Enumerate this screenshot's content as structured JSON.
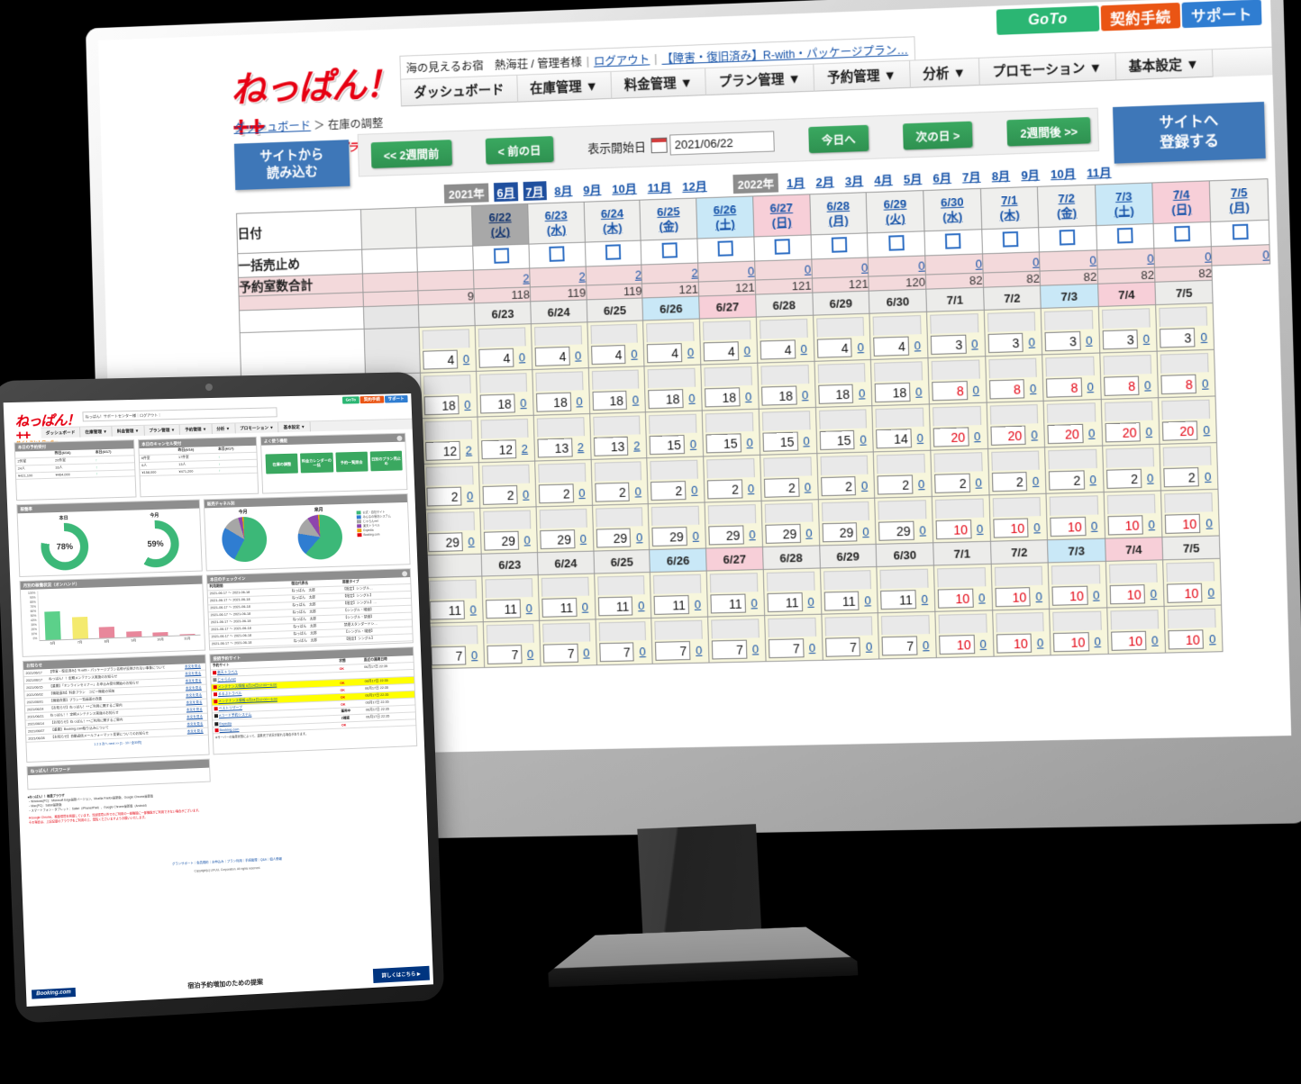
{
  "desktop": {
    "util_buttons": [
      {
        "name": "goto",
        "label": "GoTo",
        "color": "#2bb673"
      },
      {
        "name": "contract",
        "label": "契約手続",
        "color": "#ea5514"
      },
      {
        "name": "support",
        "label": "サポート",
        "color": "#2f7dd1"
      }
    ],
    "account": {
      "property": "海の見えるお宿　熱海荘 / 管理者様",
      "logout": "ログアウト",
      "notice": "【障害・復旧済み】R-with・パッケージプラン…"
    },
    "logo": {
      "line1": "ねっぱん！",
      "plus": "++",
      "line2": "サイトコントローラー",
      "line2b": "プラスプラス"
    },
    "nav": [
      "ダッシュボード",
      "在庫管理 ▼",
      "料金管理 ▼",
      "プラン管理 ▼",
      "予約管理 ▼",
      "分析 ▼",
      "プロモーション ▼",
      "基本設定 ▼"
    ],
    "breadcrumb": {
      "root": "ダッシュボード",
      "sep": "＞",
      "current": "在庫の調整"
    },
    "toolbar": {
      "load_button": [
        "サイトから",
        "読み込む"
      ],
      "prev_2week": "<< 2週間前",
      "prev_day": "< 前の日",
      "start_label": "表示開始日",
      "start_date": "2021/06/22",
      "today": "今日へ",
      "next_day": "次の日 >",
      "next_2week": "2週間後 >>",
      "register_button": [
        "サイトへ",
        "登録する"
      ]
    },
    "month_nav": {
      "year1": "2021年",
      "months1": [
        "6月",
        "7月",
        "8月",
        "9月",
        "10月",
        "11月",
        "12月"
      ],
      "active1": [
        "6月",
        "7月"
      ],
      "year2": "2022年",
      "months2": [
        "1月",
        "2月",
        "3月",
        "4月",
        "5月",
        "6月",
        "7月",
        "8月",
        "9月",
        "10月",
        "11月"
      ]
    },
    "table": {
      "row_labels": [
        "日付",
        "一括売止め",
        "予約室数合計"
      ],
      "days": [
        {
          "date": "6/22",
          "dow": "(火)",
          "kind": "today"
        },
        {
          "date": "6/23",
          "dow": "(水)",
          "kind": "wd"
        },
        {
          "date": "6/24",
          "dow": "(木)",
          "kind": "wd"
        },
        {
          "date": "6/25",
          "dow": "(金)",
          "kind": "wd"
        },
        {
          "date": "6/26",
          "dow": "(土)",
          "kind": "sat"
        },
        {
          "date": "6/27",
          "dow": "(日)",
          "kind": "sun"
        },
        {
          "date": "6/28",
          "dow": "(月)",
          "kind": "wd"
        },
        {
          "date": "6/29",
          "dow": "(火)",
          "kind": "wd"
        },
        {
          "date": "6/30",
          "dow": "(水)",
          "kind": "wd"
        },
        {
          "date": "7/1",
          "dow": "(木)",
          "kind": "wd"
        },
        {
          "date": "7/2",
          "dow": "(金)",
          "kind": "wd"
        },
        {
          "date": "7/3",
          "dow": "(土)",
          "kind": "sat"
        },
        {
          "date": "7/4",
          "dow": "(日)",
          "kind": "sun"
        },
        {
          "date": "7/5",
          "dow": "(月)",
          "kind": "wd"
        }
      ],
      "reserved_total": [
        "2",
        "2",
        "2",
        "2",
        "0",
        "0",
        "0",
        "0",
        "0",
        "0",
        "0",
        "0",
        "0",
        "0"
      ],
      "capacity_total": [
        "119",
        "118",
        "119",
        "119",
        "121",
        "121",
        "121",
        "121",
        "120",
        "82",
        "82",
        "82",
        "82",
        "82"
      ],
      "plan_rows": [
        {
          "values": [
            "4",
            "4",
            "4",
            "4",
            "4",
            "4",
            "4",
            "4",
            "4",
            "3",
            "3",
            "3",
            "3",
            "3"
          ],
          "zeros": [
            "0",
            "0",
            "0",
            "0",
            "0",
            "0",
            "0",
            "0",
            "0",
            "0",
            "0",
            "0",
            "0",
            "0"
          ],
          "red": false
        },
        {
          "values": [
            "18",
            "18",
            "18",
            "18",
            "18",
            "18",
            "18",
            "18",
            "18",
            "8",
            "8",
            "8",
            "8",
            "8"
          ],
          "zeros": [
            "0",
            "0",
            "0",
            "0",
            "0",
            "0",
            "0",
            "0",
            "0",
            "0",
            "0",
            "0",
            "0",
            "0"
          ],
          "red": "tail"
        },
        {
          "values": [
            "12",
            "12",
            "13",
            "13",
            "15",
            "15",
            "15",
            "15",
            "14",
            "20",
            "20",
            "20",
            "20",
            "20"
          ],
          "zeros": [
            "2",
            "2",
            "2",
            "2",
            "0",
            "0",
            "0",
            "0",
            "0",
            "0",
            "0",
            "0",
            "0",
            "0"
          ],
          "red": "tail"
        },
        {
          "values": [
            "2",
            "2",
            "2",
            "2",
            "2",
            "2",
            "2",
            "2",
            "2",
            "2",
            "2",
            "2",
            "2",
            "2"
          ],
          "zeros": [
            "0",
            "0",
            "0",
            "0",
            "0",
            "0",
            "0",
            "0",
            "0",
            "0",
            "0",
            "0",
            "0",
            "0"
          ],
          "red": false
        },
        {
          "values": [
            "29",
            "29",
            "29",
            "29",
            "29",
            "29",
            "29",
            "29",
            "29",
            "10",
            "10",
            "10",
            "10",
            "10"
          ],
          "zeros": [
            "0",
            "0",
            "0",
            "0",
            "0",
            "0",
            "0",
            "0",
            "0",
            "0",
            "0",
            "0",
            "0",
            "0"
          ],
          "red": "tail"
        }
      ],
      "plan_rows2": [
        {
          "values": [
            "11",
            "11",
            "11",
            "11",
            "11",
            "11",
            "11",
            "11",
            "11",
            "10",
            "10",
            "10",
            "10",
            "10"
          ],
          "zeros": [
            "0",
            "0",
            "0",
            "0",
            "0",
            "0",
            "0",
            "0",
            "0",
            "0",
            "0",
            "0",
            "0",
            "0"
          ],
          "red": "tail"
        },
        {
          "values": [
            "7",
            "7",
            "7",
            "7",
            "7",
            "7",
            "7",
            "7",
            "7",
            "10",
            "10",
            "10",
            "10",
            "10"
          ],
          "zeros": [
            "0",
            "0",
            "0",
            "0",
            "0",
            "0",
            "0",
            "0",
            "0",
            "0",
            "0",
            "0",
            "0",
            "0"
          ],
          "red": "tail"
        }
      ]
    }
  },
  "tablet": {
    "util_buttons": [
      "GoTo",
      "契約手続",
      "サポート"
    ],
    "account": "ねっぱん！サポートセンター様｜ログアウト｜",
    "logo": {
      "a": "ねっぱん！++",
      "b": "サイトコントローラー"
    },
    "nav": [
      "ダッシュボード",
      "在庫管理 ▼",
      "料金管理 ▼",
      "プラン管理 ▼",
      "予約管理 ▼",
      "分析 ▼",
      "プロモーション ▼",
      "基本設定 ▼"
    ],
    "cards": {
      "today_bookings": {
        "title": "本日の予約受付",
        "columns": [
          "",
          "昨日(6/16)",
          "本日(6/17)",
          ""
        ],
        "rows": [
          [
            "2件室",
            "20件室",
            "↑"
          ],
          [
            "24人",
            "33人",
            "↑"
          ],
          [
            "¥421,100",
            "¥464,000",
            "↑"
          ]
        ]
      },
      "today_cancels": {
        "title": "本日のキャンセル受付",
        "columns": [
          "",
          "昨日(6/16)",
          "本日(6/17)",
          ""
        ],
        "rows": [
          [
            "6件室",
            "17件室",
            "↑"
          ],
          [
            "6人",
            "13人",
            "↑"
          ],
          [
            "¥158,000",
            "¥471,200",
            "↑"
          ]
        ]
      },
      "quick": {
        "title": "よく使う機能",
        "buttons": [
          "在庫の調整",
          "料金カレンダーの一括",
          "予約一覧照会",
          "日別のプラン売止め"
        ]
      },
      "occupancy": {
        "title": "稼働率",
        "items": [
          {
            "label": "本日",
            "value": "78%",
            "pct": 78
          },
          {
            "label": "今月",
            "value": "59%",
            "pct": 59
          }
        ]
      },
      "channels": {
        "title": "販売チャネル別",
        "legend": [
          {
            "name": "公式・自社サイト",
            "color": "#3cb878"
          },
          {
            "name": "みんなの宿泊システム",
            "color": "#2f7dd1"
          },
          {
            "name": "じゃらんnet",
            "color": "#a6a6a6"
          },
          {
            "name": "楽天トラベル",
            "color": "#8e44ad"
          },
          {
            "name": "Expedia",
            "color": "#f0a202"
          },
          {
            "name": "Booking.com",
            "color": "#e3000f"
          }
        ],
        "pies": [
          {
            "label": "今月",
            "slices": [
              {
                "color": "#3cb878",
                "pct": 58
              },
              {
                "color": "#2f7dd1",
                "pct": 26
              },
              {
                "color": "#a6a6a6",
                "pct": 12
              },
              {
                "color": "#8e44ad",
                "pct": 3
              },
              {
                "color": "#f0a202",
                "pct": 1
              }
            ]
          },
          {
            "label": "来月",
            "slices": [
              {
                "color": "#3cb878",
                "pct": 62
              },
              {
                "color": "#2f7dd1",
                "pct": 16
              },
              {
                "color": "#a6a6a6",
                "pct": 13
              },
              {
                "color": "#8e44ad",
                "pct": 8
              },
              {
                "color": "#f0a202",
                "pct": 1
              }
            ]
          }
        ]
      },
      "monthly": {
        "title": "月別の稼働状況（オンハンド）",
        "y_ticks": [
          "100%",
          "90%",
          "80%",
          "70%",
          "60%",
          "50%",
          "40%",
          "30%",
          "20%",
          "10%",
          "0%"
        ],
        "categories": [
          "6月",
          "7月",
          "8月",
          "9月",
          "10月",
          "11月"
        ],
        "values": [
          57,
          44,
          22,
          11,
          7,
          1
        ],
        "colors": [
          "#5cd08a",
          "#f4ea6e",
          "#e8879b",
          "#e8879b",
          "#e8879b",
          "#e8879b"
        ]
      },
      "checkin": {
        "title": "本日のチェックイン",
        "columns": [
          "利用期間",
          "宿泊代表名",
          "部屋タイプ"
        ],
        "rows": [
          [
            "2021-06-17 ～ 2021-06-18",
            "ねっぱん　太郎",
            "【限定】シングル…"
          ],
          [
            "2021-06-17 ～ 2021-06-18",
            "ねっぱん　太郎",
            "【限定】シングル】"
          ],
          [
            "2021-06-17 ～ 2021-06-18",
            "ねっぱん　太郎",
            "【限定】シングル】…"
          ],
          [
            "2021-06-17 ～ 2021-06-18",
            "ねっぱん　太郎",
            "【シングル・喫煙】"
          ],
          [
            "2021-06-17 ～ 2021-06-18",
            "ねっぱん　太郎",
            "【シングル・禁煙】"
          ],
          [
            "2021-06-17 ～ 2021-06-18",
            "ねっぱん　太郎",
            "禁煙スタンダードシ…"
          ],
          [
            "2021-06-17 ～ 2021-06-18",
            "ねっぱん　太郎",
            "【シングル・喫煙】"
          ],
          [
            "2021-06-17 ～ 2021-06-18",
            "ねっぱん　太郎",
            "【限定】シングル】"
          ]
        ]
      },
      "news": {
        "title": "お知らせ",
        "rows": [
          [
            "2021/06/17",
            "【障害・復旧済み】R-with・パッケージプラン名称が反映されない事象について",
            "本文を見る"
          ],
          [
            "2021/06/17",
            "ねっぱん！！定期メンテナンス実施のお知らせ",
            "本文を見る"
          ],
          [
            "2021/06/15",
            "【重要】「オンラインセミナー」お申込み受付開始のお知らせ",
            "本文を見る"
          ],
          [
            "2021/06/02",
            "【機能追加】料金プラン　コピー機能の追加",
            "本文を見る"
          ],
          [
            "2021/06/01",
            "【機能改善】プラン一覧画面の改善",
            "本文を見る"
          ],
          [
            "2021/06/24",
            "【お知らせ】ねっぱん！++ご利用に関するご案内",
            "本文を見る"
          ],
          [
            "2021/06/21",
            "ねっぱん！！定期メンテナンス実施のお知らせ",
            "本文を見る"
          ],
          [
            "2021/06/14",
            "【お知らせ】ねっぱん！++ご利用に関するご案内",
            "本文を見る"
          ],
          [
            "2021/06/07",
            "【重要】Booking.com取り込みについて",
            "本文を見る"
          ],
          [
            "2021/06/28",
            "【お知らせ】自動返信メールフォーマット変更についてのお知らせ",
            "本文を見る"
          ]
        ],
        "pager": "1 2 3 次へ  next >>  [1 - 10 / 全30件]"
      },
      "sites": {
        "title": "接続予約サイト",
        "columns": [
          "予約サイト",
          "状態",
          "直近の連携日時"
        ],
        "rows": [
          {
            "name": "楽天トラベル",
            "status": "OK",
            "status_color": "#e3000f",
            "time": "06月17日 22:35",
            "highlight": false
          },
          {
            "name": "じゃらんnet",
            "status": "",
            "status_color": "",
            "time": "",
            "highlight": false
          },
          {
            "name": "メンテナンス情報\n6月24日12:00～6:00",
            "status": "OK",
            "status_color": "#e3000f",
            "time": "06月17日 22:35",
            "highlight": true
          },
          {
            "name": "るるぶトラベル",
            "status": "OK",
            "status_color": "#e3000f",
            "time": "06月17日 22:35",
            "highlight": false
          },
          {
            "name": "メンテナンス情報\n6月24日12:00～6:00",
            "status": "OK",
            "status_color": "#e3000f",
            "time": "06月17日 22:35",
            "highlight": true
          },
          {
            "name": "ベストリザーブ",
            "status": "OK",
            "status_color": "#e3000f",
            "time": "06月17日 22:35",
            "highlight": false
          },
          {
            "name": "Aコード予約システム",
            "status": "運用中",
            "status_color": "#222",
            "time": "06月17日 22:35",
            "highlight": false
          },
          {
            "name": "Expedia",
            "status": "Z確認",
            "status_color": "#222",
            "time": "06月17日 22:35",
            "highlight": false
          },
          {
            "name": "Booking.com",
            "status": "OK",
            "status_color": "#e3000f",
            "time": "",
            "highlight": false
          }
        ],
        "note": "※サーバーの負荷状態によって、連携完了状況が遅れる場合があります。"
      },
      "password": {
        "title": "ねっぱん！パスワード"
      }
    },
    "footnote": {
      "heading": "■ねっぱん！！推奨ブラウザ",
      "lines": [
        "・Windows(PC)：Microsoft Edge最新バージョン、Mozilla Firefox最新版、Google Chrome最新版",
        "・Mac(PC)：Safari最新版",
        "・スマートフォン・タブレット：Safari（iPhone/iPad）、Google Chrome最新版（Android）"
      ],
      "red": [
        "※Google Chrome、推奨環境を掲載しています。当該環境以外でのご利用の一部機能に一部機能がご利用できない場合がございます。",
        "その場合は、上記記載のブラウザをご利用の上、閲覧くださいますようお願いいたします。"
      ]
    },
    "footer_links": "グランサポート｜会員規約｜お申込み｜プラン利用｜手続管理｜Q&A｜個人情報",
    "copyright": "Copyright(c) LIFULL Corporation. All rights reserved.",
    "booking": {
      "logo": "Booking.com",
      "text": "宿泊予約増加のための提案",
      "cta": "詳しくはこちら ▶"
    }
  }
}
